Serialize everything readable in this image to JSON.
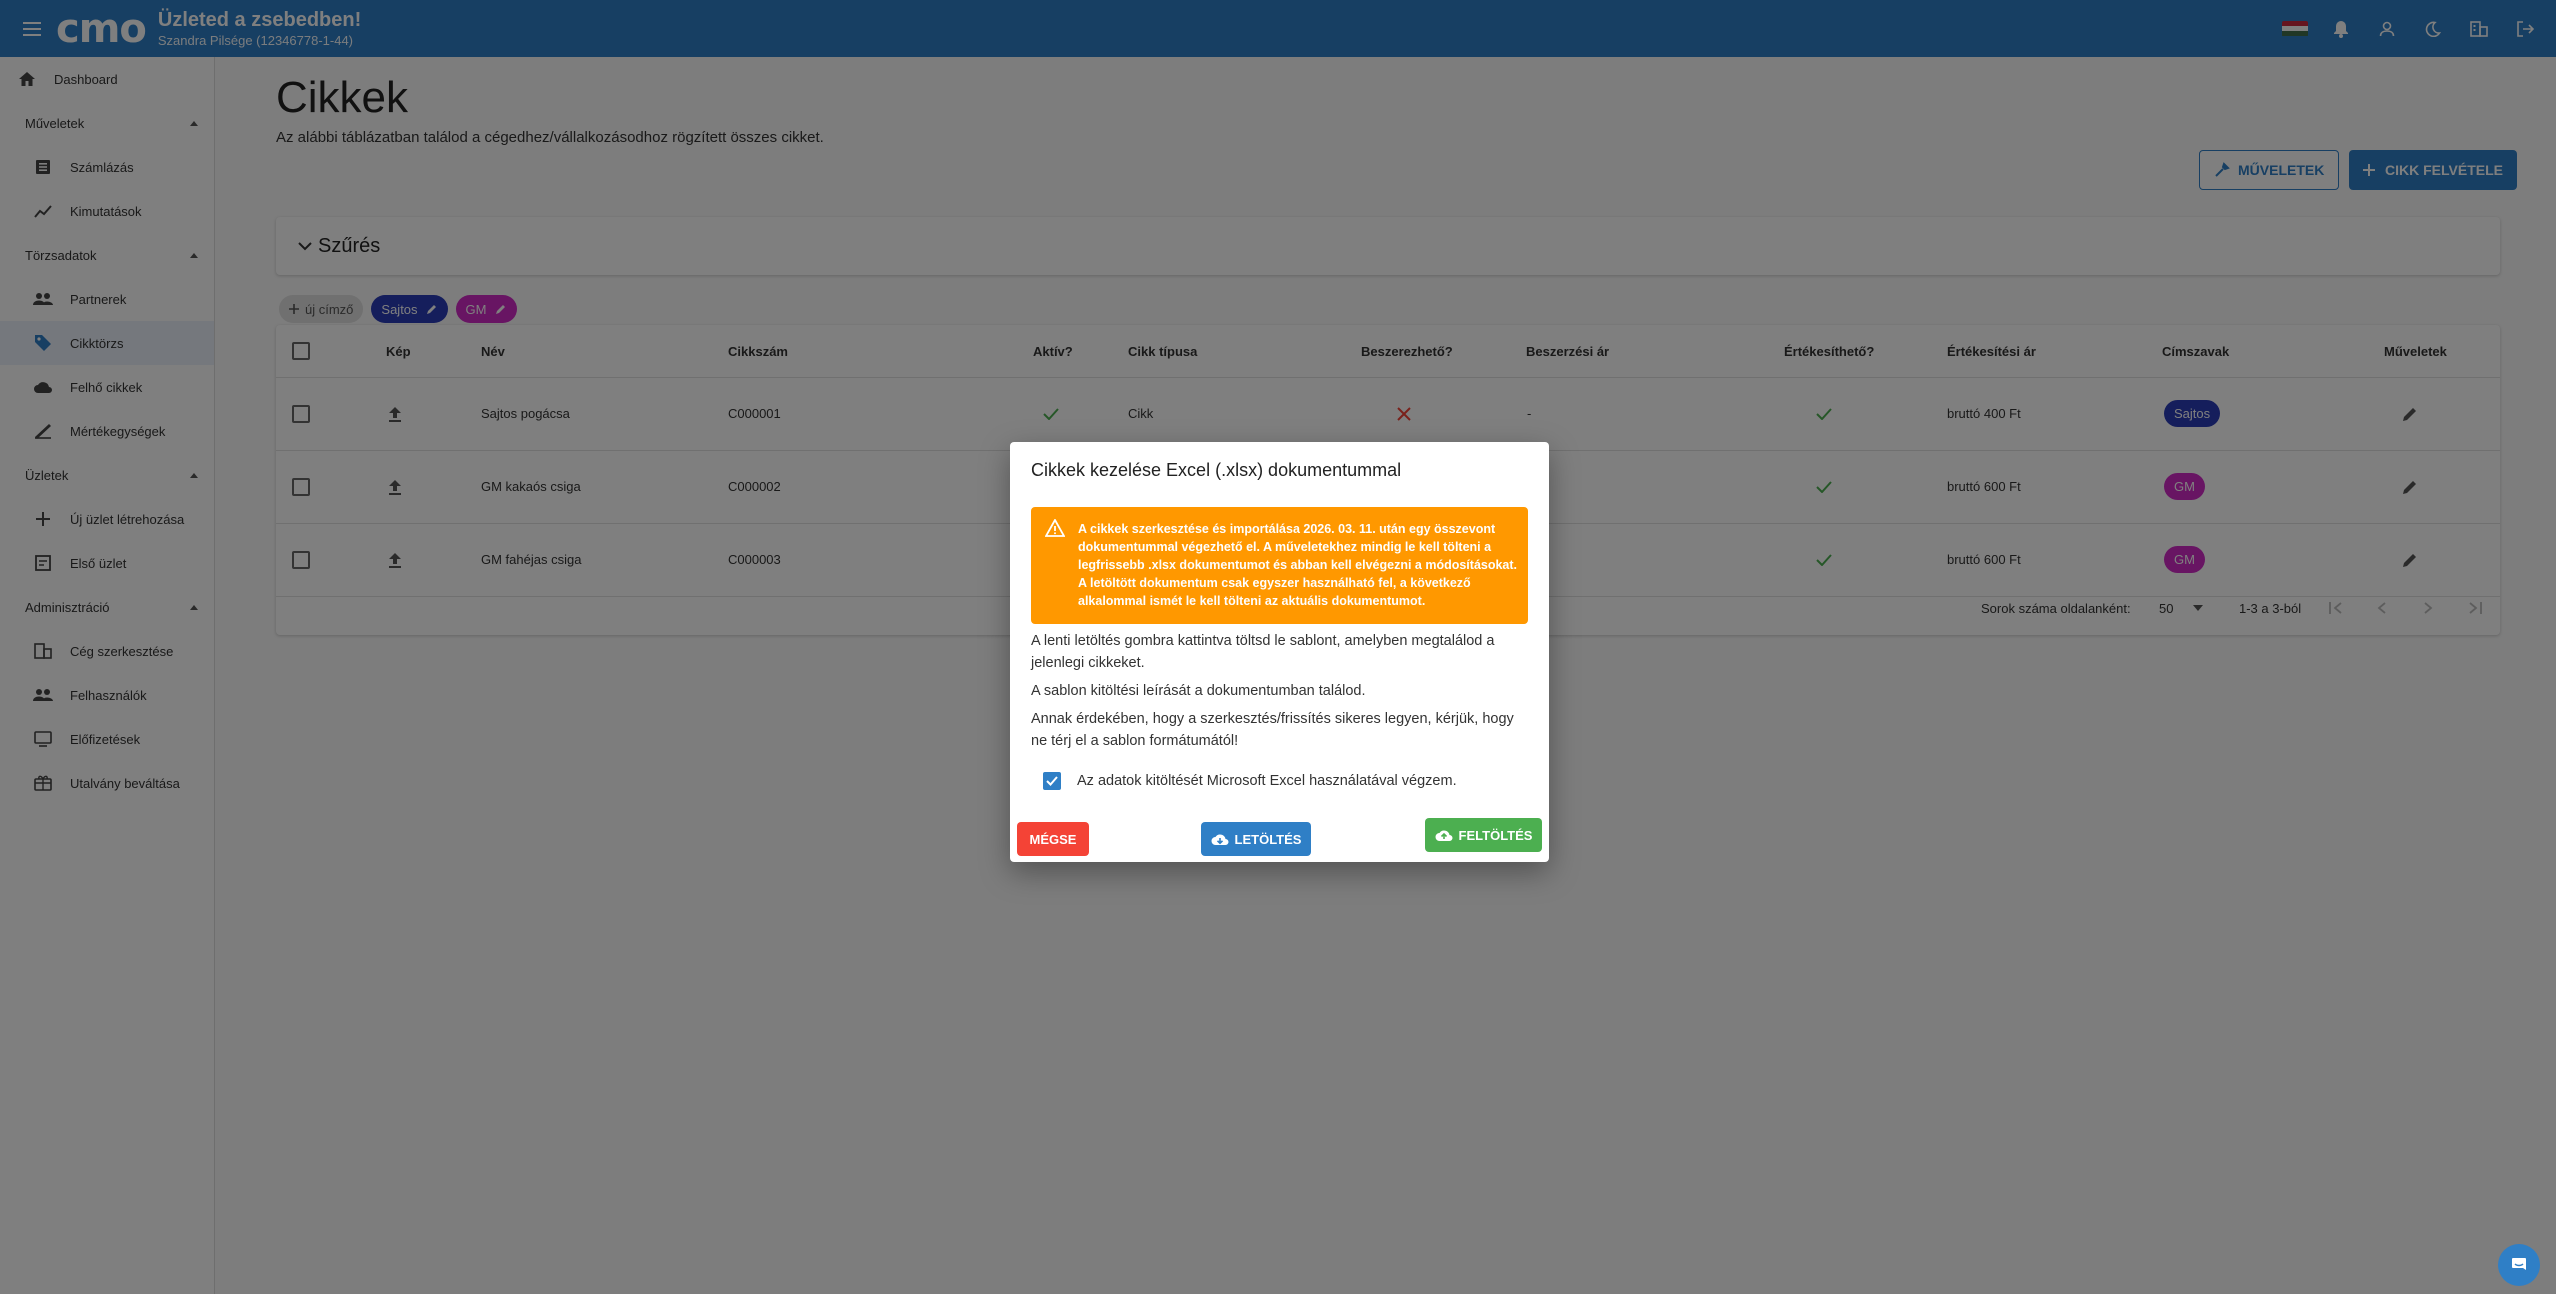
{
  "topbar": {
    "logo": "cmo",
    "app_title": "Üzleted a zsebedben!",
    "company": "Szandra Pilsége (12346778-1-44)",
    "flag_colors": [
      "#cd2a3e",
      "#ffffff",
      "#436f4d"
    ],
    "icons": [
      "flag-hu-icon",
      "bell-icon",
      "account-icon",
      "dark-mode-icon",
      "company-icon",
      "logout-icon"
    ]
  },
  "sidebar": {
    "dashboard": "Dashboard",
    "sections": [
      {
        "label": "Műveletek",
        "items": [
          "Számlázás",
          "Kimutatások"
        ]
      },
      {
        "label": "Törzsadatok",
        "items": [
          "Partnerek",
          "Cikktörzs",
          "Felhő cikkek",
          "Mértékegységek"
        ]
      },
      {
        "label": "Üzletek",
        "items": [
          "Új üzlet létrehozása",
          "Első üzlet"
        ]
      },
      {
        "label": "Adminisztráció",
        "items": [
          "Cég szerkesztése",
          "Felhasználók",
          "Előfizetések",
          "Utalvány beváltása"
        ]
      }
    ],
    "active_item": "Cikktörzs"
  },
  "page": {
    "title": "Cikkek",
    "subtitle": "Az alábbi táblázatban találod a cégedhez/vállalkozásodhoz rögzített összes cikket.",
    "btn_operations": "MŰVELETEK",
    "btn_add": "CIKK FELVÉTELE",
    "filter_title": "Szűrés",
    "chips": {
      "new": "új címző",
      "sajtos": "Sajtos",
      "gm": "GM"
    }
  },
  "table": {
    "headers": [
      "Kép",
      "Név",
      "Cikkszám",
      "Aktív?",
      "Cikk típusa",
      "Beszerezhető?",
      "Beszerzési ár",
      "Értékesíthető?",
      "Értékesítési ár",
      "Címszavak",
      "Műveletek"
    ],
    "rows": [
      {
        "name": "Sajtos pogácsa",
        "code": "C000001",
        "type": "Cikk",
        "purchase_price": "-",
        "sale_price": "bruttó 400 Ft",
        "tag": "Sajtos"
      },
      {
        "name": "GM kakaós csiga",
        "code": "C000002",
        "type": "",
        "purchase_price": "",
        "sale_price": "bruttó 600 Ft",
        "tag": "GM"
      },
      {
        "name": "GM fahéjas csiga",
        "code": "C000003",
        "type": "",
        "purchase_price": "",
        "sale_price": "bruttó 600 Ft",
        "tag": "GM"
      }
    ],
    "footer": {
      "rows_per_page_label": "Sorok száma oldalanként:",
      "rows_per_page": "50",
      "range": "1-3 a 3-ból"
    }
  },
  "dialog": {
    "title": "Cikkek kezelése Excel (.xlsx) dokumentummal",
    "warning": "A cikkek szerkesztése és importálása 2026. 03. 11. után egy összevont dokumentummal végezhető el. A műveletekhez mindig le kell tölteni a legfrissebb .xlsx dokumentumot és abban kell elvégezni a módosításokat. A letöltött dokumentum csak egyszer használható fel, a következő alkalommal ismét le kell tölteni az aktuális dokumentumot.",
    "p1": "A lenti letöltés gombra kattintva töltsd le sablont, amelyben megtalálod a jelenlegi cikkeket.",
    "p2": "A sablon kitöltési leírását a dokumentumban találod.",
    "p3": "Annak érdekében, hogy a szerkesztés/frissítés sikeres legyen, kérjük, hogy ne térj el a sablon formátumától!",
    "checkbox_label": "Az adatok kitöltését Microsoft Excel használatával végzem.",
    "checkbox_checked": true,
    "btn_cancel": "MÉGSE",
    "btn_download": "LETÖLTÉS",
    "btn_upload": "FELTÖLTÉS",
    "colors": {
      "warning": "#ff9800",
      "cancel": "#f44336",
      "download": "#2f7fc6",
      "upload": "#4caf50"
    }
  }
}
